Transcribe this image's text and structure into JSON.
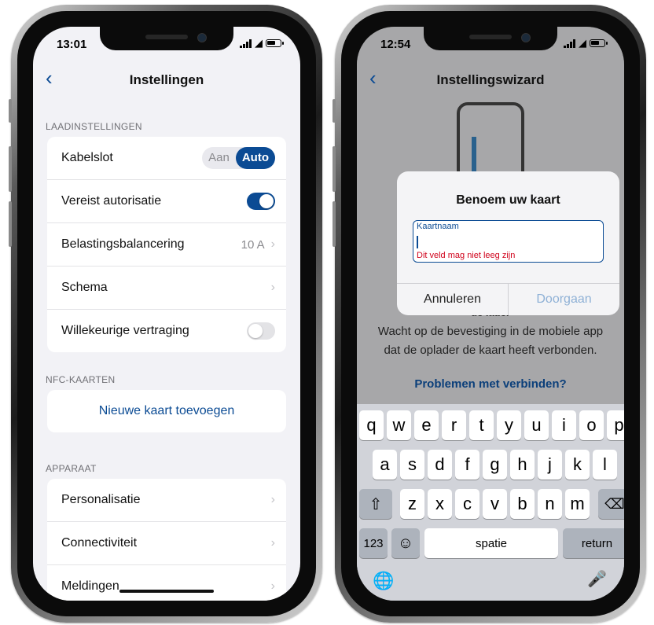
{
  "left_phone": {
    "status_time": "13:01",
    "nav_title": "Instellingen",
    "sections": {
      "laad": {
        "header": "LAADINSTELLINGEN",
        "rows": {
          "kabelslot": {
            "label": "Kabelslot",
            "options": [
              "Aan",
              "Auto"
            ],
            "selected": "Auto"
          },
          "autorisatie": {
            "label": "Vereist autorisatie",
            "enabled": true
          },
          "balancering": {
            "label": "Belastingsbalancering",
            "value": "10 A"
          },
          "schema": {
            "label": "Schema"
          },
          "vertraging": {
            "label": "Willekeurige vertraging",
            "enabled": false
          }
        }
      },
      "nfc": {
        "header": "NFC-KAARTEN",
        "add_label": "Nieuwe kaart toevoegen"
      },
      "apparaat": {
        "header": "APPARAAT",
        "items": [
          "Personalisatie",
          "Connectiviteit",
          "Meldingen"
        ]
      }
    }
  },
  "right_phone": {
    "status_time": "12:54",
    "nav_title": "Instellingswizard",
    "background": {
      "partial_line": "de lader",
      "wait_text": [
        "Wacht op de bevestiging in de mobiele app",
        "dat de oplader de kaart heeft verbonden."
      ],
      "help_link": "Problemen met verbinden?"
    },
    "dialog": {
      "title": "Benoem uw kaart",
      "field_label": "Kaartnaam",
      "field_value": "",
      "error_text": "Dit veld mag niet leeg zijn",
      "cancel_label": "Annuleren",
      "confirm_label": "Doorgaan"
    },
    "keyboard": {
      "row1": [
        "q",
        "w",
        "e",
        "r",
        "t",
        "y",
        "u",
        "i",
        "o",
        "p"
      ],
      "row2": [
        "a",
        "s",
        "d",
        "f",
        "g",
        "h",
        "j",
        "k",
        "l"
      ],
      "row3": [
        "z",
        "x",
        "c",
        "v",
        "b",
        "n",
        "m"
      ],
      "numbers_label": "123",
      "space_label": "spatie",
      "return_label": "return"
    }
  },
  "colors": {
    "accent": "#0b4b94",
    "error": "#d0021b",
    "disabled_link": "#8fb1d6"
  }
}
